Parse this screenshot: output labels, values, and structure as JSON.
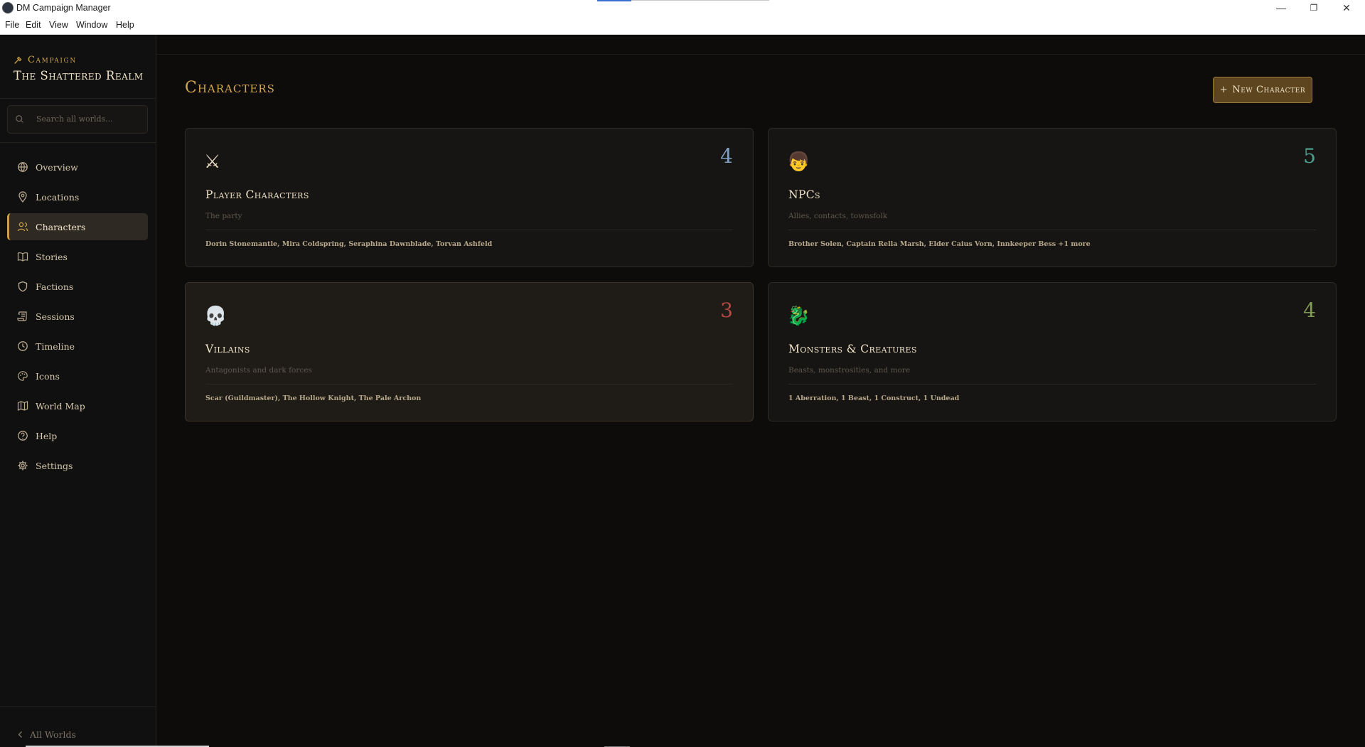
{
  "window": {
    "title": "DM Campaign Manager",
    "controls": {
      "minimize": "—",
      "restore": "❐",
      "close": "✕"
    }
  },
  "menu": [
    "File",
    "Edit",
    "View",
    "Window",
    "Help"
  ],
  "sidebar": {
    "eyebrow": "Campaign",
    "world_name": "The Shattered Realm",
    "search_placeholder": "Search all worlds...",
    "items": [
      {
        "label": "Overview",
        "icon": "globe-icon"
      },
      {
        "label": "Locations",
        "icon": "map-pin-icon"
      },
      {
        "label": "Characters",
        "icon": "users-icon",
        "active": true
      },
      {
        "label": "Stories",
        "icon": "book-icon"
      },
      {
        "label": "Factions",
        "icon": "shield-icon"
      },
      {
        "label": "Sessions",
        "icon": "scroll-icon"
      },
      {
        "label": "Timeline",
        "icon": "clock-icon"
      },
      {
        "label": "Icons",
        "icon": "palette-icon"
      },
      {
        "label": "World Map",
        "icon": "map-icon"
      },
      {
        "label": "Help",
        "icon": "help-circle-icon"
      },
      {
        "label": "Settings",
        "icon": "gear-icon"
      }
    ],
    "footer_label": "All Worlds"
  },
  "main": {
    "title": "Characters",
    "new_button_label": "New Character",
    "cards": [
      {
        "icon": "⚔",
        "count": "4",
        "count_color": "#7f9fc2",
        "title": "Player Characters",
        "subtitle": "The party",
        "members": "Dorin Stonemantle, Mira Coldspring, Seraphina Dawnblade, Torvan Ashfeld"
      },
      {
        "icon": "👦",
        "count": "5",
        "count_color": "#4aa08d",
        "title": "NPCs",
        "subtitle": "Allies, contacts, townsfolk",
        "members": "Brother Solen, Captain Rella Marsh, Elder Caius Vorn, Innkeeper Bess +1 more"
      },
      {
        "icon": "💀",
        "count": "3",
        "count_color": "#b24a44",
        "title": "Villains",
        "subtitle": "Antagonists and dark forces",
        "members": "Scar (Guildmaster), The Hollow Knight, The Pale Archon"
      },
      {
        "icon": "🐉",
        "count": "4",
        "count_color": "#7f9a52",
        "title": "Monsters & Creatures",
        "subtitle": "Beasts, monstrosities, and more",
        "members": "1 Aberration, 1 Beast, 1 Construct, 1 Undead"
      }
    ]
  }
}
